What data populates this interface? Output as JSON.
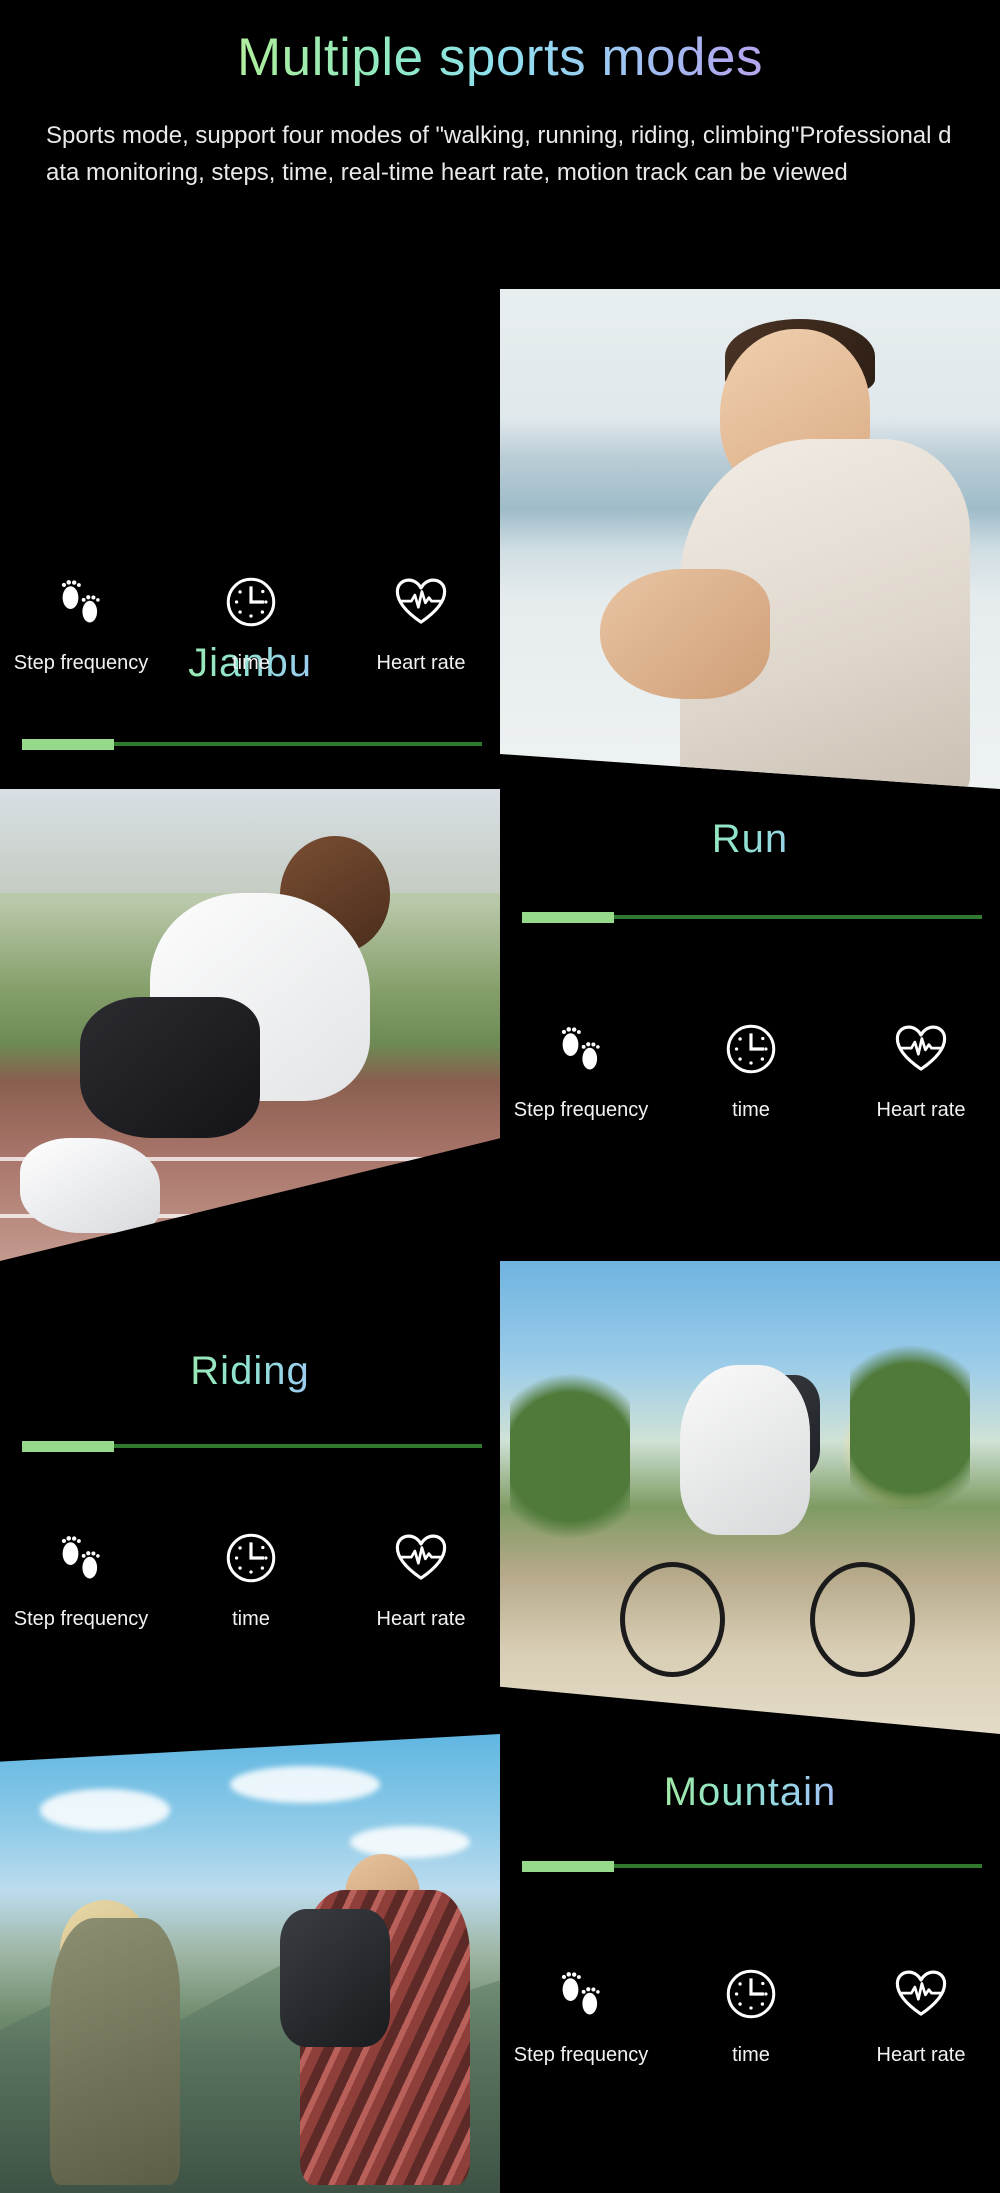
{
  "header": {
    "title": "Multiple sports modes",
    "description": "Sports mode, support four modes of \"walking, running, riding, climbing\"Professional data monitoring, steps, time, real-time heart rate, motion track can be viewed"
  },
  "metrics_labels": {
    "step_frequency": "Step frequency",
    "time": "time",
    "heart_rate": "Heart rate"
  },
  "icons": {
    "footprints": "footprints-icon",
    "clock": "clock-icon",
    "heart_pulse": "heart-pulse-icon"
  },
  "colors": {
    "background": "#000000",
    "progress_fill": "#96d98a",
    "progress_track": "#2f7a2f",
    "label_text": "#f2f2f2",
    "description_text": "#e9e9e9",
    "gradient_stops": [
      "#f3f0a6",
      "#a8eda0",
      "#8fe0ee",
      "#9cc8f2",
      "#b0a8ee",
      "#f0a8d6"
    ]
  },
  "sections": [
    {
      "id": "jianbu",
      "title": "Jianbu",
      "progress_percent": 20,
      "photo_alt": "man jogging by the sea",
      "photo_side": "right",
      "metrics": [
        {
          "icon": "footprints-icon",
          "label": "Step frequency"
        },
        {
          "icon": "clock-icon",
          "label": "time"
        },
        {
          "icon": "heart-pulse-icon",
          "label": "Heart rate"
        }
      ]
    },
    {
      "id": "run",
      "title": "Run",
      "progress_percent": 20,
      "photo_alt": "sprinter at starting blocks on track",
      "photo_side": "left",
      "metrics": [
        {
          "icon": "footprints-icon",
          "label": "Step frequency"
        },
        {
          "icon": "clock-icon",
          "label": "time"
        },
        {
          "icon": "heart-pulse-icon",
          "label": "Heart rate"
        }
      ]
    },
    {
      "id": "riding",
      "title": "Riding",
      "progress_percent": 20,
      "photo_alt": "man riding a mountain bike on a dirt path",
      "photo_side": "right",
      "metrics": [
        {
          "icon": "footprints-icon",
          "label": "Step frequency"
        },
        {
          "icon": "clock-icon",
          "label": "time"
        },
        {
          "icon": "heart-pulse-icon",
          "label": "Heart rate"
        }
      ]
    },
    {
      "id": "mountain",
      "title": "Mountain",
      "progress_percent": 20,
      "photo_alt": "two hikers with backpacks on a mountain",
      "photo_side": "left",
      "metrics": [
        {
          "icon": "footprints-icon",
          "label": "Step frequency"
        },
        {
          "icon": "clock-icon",
          "label": "time"
        },
        {
          "icon": "heart-pulse-icon",
          "label": "Heart rate"
        }
      ]
    }
  ]
}
